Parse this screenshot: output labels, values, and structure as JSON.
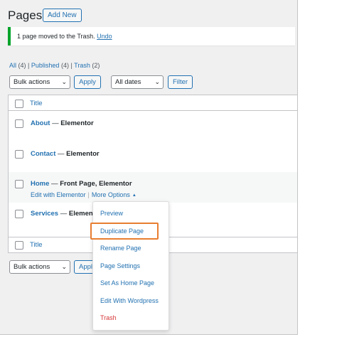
{
  "header": {
    "title": "Pages",
    "add_new": "Add New"
  },
  "notice": {
    "message": "1 page moved to the Trash.",
    "undo": "Undo"
  },
  "filters": {
    "all_label": "All",
    "all_count": "(4)",
    "published_label": "Published",
    "published_count": "(4)",
    "trash_label": "Trash",
    "trash_count": "(2)",
    "sep": "|"
  },
  "toolbar": {
    "bulk_actions": "Bulk actions",
    "apply": "Apply",
    "all_dates": "All dates",
    "filter": "Filter"
  },
  "table": {
    "column_title": "Title",
    "rows": [
      {
        "title": "About",
        "state": "Elementor"
      },
      {
        "title": "Contact",
        "state": "Elementor"
      },
      {
        "title": "Home",
        "state": "Front Page, Elementor"
      },
      {
        "title": "Services",
        "state": "Element"
      }
    ],
    "dash": " — ",
    "row_actions": {
      "edit": "Edit with Elementor",
      "sep": "|",
      "more": "More Options"
    }
  },
  "bottom_toolbar": {
    "bulk_actions": "Bulk actions",
    "apply": "Appl"
  },
  "dropdown": {
    "items": [
      "Preview",
      "Duplicate Page",
      "Rename Page",
      "Page Settings",
      "Set As Home Page",
      "Edit With Wordpress",
      "Trash"
    ]
  },
  "colors": {
    "link": "#2271b1",
    "highlight": "#e87e30",
    "notice_border": "#00a32a",
    "trash": "#d63638"
  }
}
